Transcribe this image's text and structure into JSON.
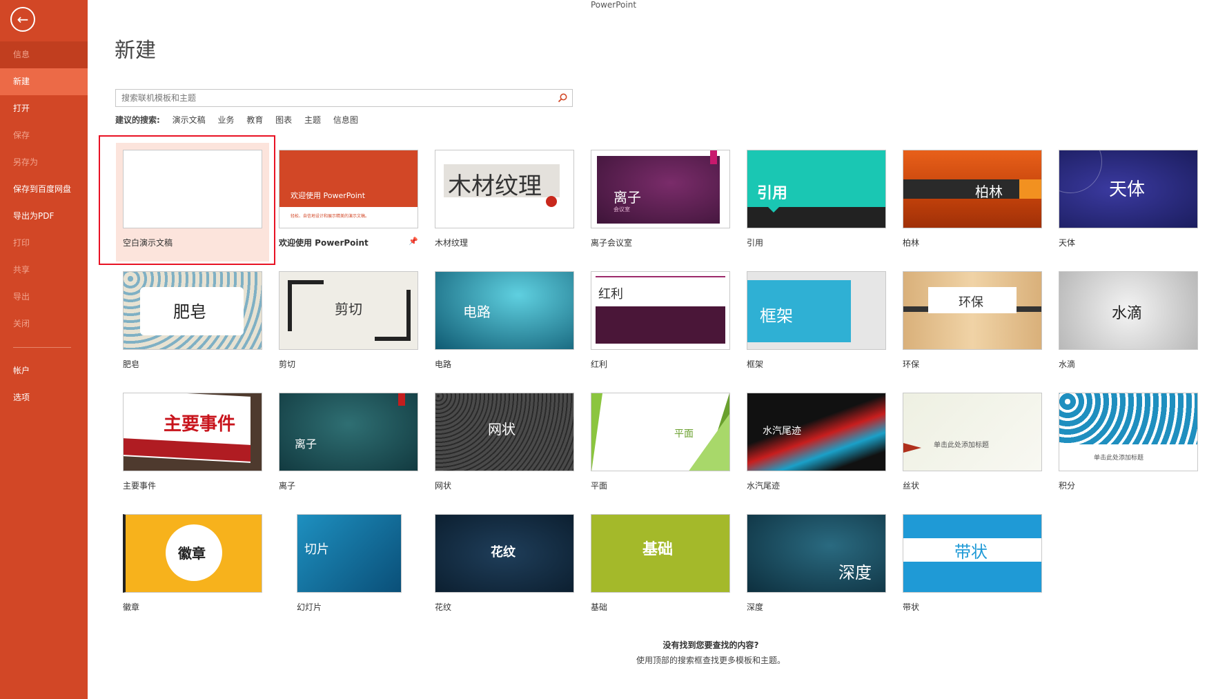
{
  "app_title": "PowerPoint",
  "page_title": "新建",
  "sidebar": {
    "back_icon": "arrow-left-icon",
    "items": [
      {
        "label": "信息",
        "state": "dim"
      },
      {
        "label": "新建",
        "state": "active"
      },
      {
        "label": "打开",
        "state": "normal"
      },
      {
        "label": "保存",
        "state": "disabled"
      },
      {
        "label": "另存为",
        "state": "disabled"
      },
      {
        "label": "保存到百度网盘",
        "state": "normal"
      },
      {
        "label": "导出为PDF",
        "state": "normal"
      },
      {
        "label": "打印",
        "state": "disabled"
      },
      {
        "label": "共享",
        "state": "disabled"
      },
      {
        "label": "导出",
        "state": "disabled"
      },
      {
        "label": "关闭",
        "state": "disabled"
      },
      {
        "label": "帐户",
        "state": "normal"
      },
      {
        "label": "选项",
        "state": "normal"
      }
    ]
  },
  "search": {
    "placeholder": "搜索联机模板和主题"
  },
  "suggestions": {
    "label": "建议的搜索:",
    "links": [
      "演示文稿",
      "业务",
      "教育",
      "图表",
      "主题",
      "信息图"
    ]
  },
  "templates": [
    {
      "name": "空白演示文稿",
      "selected": true
    },
    {
      "name": "欢迎使用 PowerPoint",
      "thumb_title": "欢迎使用 PowerPoint",
      "thumb_sub": "轻松、自信地设计和展示精美的演示文稿。"
    },
    {
      "name": "木材纹理",
      "thumb_title": "木材纹理"
    },
    {
      "name": "离子会议室",
      "thumb_title": "离子",
      "thumb_sub": "会议室"
    },
    {
      "name": "引用",
      "thumb_title": "引用"
    },
    {
      "name": "柏林",
      "thumb_title": "柏林"
    },
    {
      "name": "天体",
      "thumb_title": "天体"
    },
    {
      "name": "肥皂",
      "thumb_title": "肥皂"
    },
    {
      "name": "剪切",
      "thumb_title": "剪切"
    },
    {
      "name": "电路",
      "thumb_title": "电路"
    },
    {
      "name": "红利",
      "thumb_title": "红利"
    },
    {
      "name": "框架",
      "thumb_title": "框架"
    },
    {
      "name": "环保",
      "thumb_title": "环保"
    },
    {
      "name": "水滴",
      "thumb_title": "水滴"
    },
    {
      "name": "主要事件",
      "thumb_title": "主要事件"
    },
    {
      "name": "离子",
      "thumb_title": "离子"
    },
    {
      "name": "网状",
      "thumb_title": "网状"
    },
    {
      "name": "平面",
      "thumb_title": "平面"
    },
    {
      "name": "水汽尾迹",
      "thumb_title": "水汽尾迹"
    },
    {
      "name": "丝状",
      "thumb_title": "单击此处添加标题"
    },
    {
      "name": "积分",
      "thumb_title": "单击此处添加标题"
    },
    {
      "name": "徽章",
      "thumb_title": "徽章"
    },
    {
      "name": "幻灯片",
      "thumb_title": "切片"
    },
    {
      "name": "花纹",
      "thumb_title": "花纹"
    },
    {
      "name": "基础",
      "thumb_title": "基础"
    },
    {
      "name": "深度",
      "thumb_title": "深度"
    },
    {
      "name": "带状",
      "thumb_title": "带状"
    }
  ],
  "footer": {
    "line1": "没有找到您要查找的内容?",
    "line2": "使用顶部的搜索框查找更多模板和主题。"
  },
  "colors": {
    "sidebar": "#d24726",
    "active": "#ec6a47",
    "selection": "#e81123"
  }
}
